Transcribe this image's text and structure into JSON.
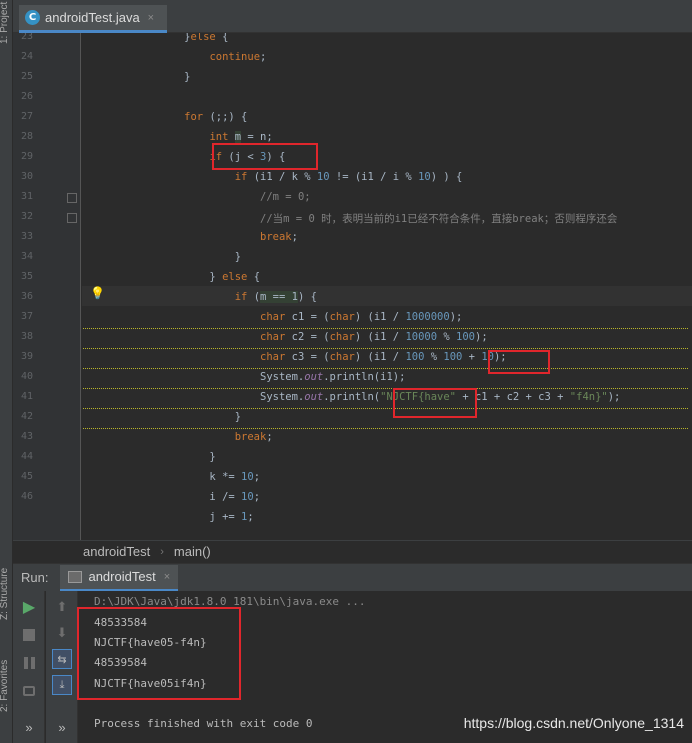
{
  "sidebar": {
    "project": "1: Project",
    "structure": "Z: Structure",
    "favorites": "2: Favorites"
  },
  "tab": {
    "icon": "java-class-icon",
    "title": "androidTest.java",
    "close": "×"
  },
  "editor": {
    "line_numbers": [
      "23",
      "24",
      "25",
      "26",
      "27",
      "28",
      "29",
      "30",
      "31",
      "32",
      "33",
      "34",
      "35",
      "36",
      "37",
      "38",
      "39",
      "40",
      "41",
      "42",
      "43",
      "44",
      "45",
      "46"
    ]
  },
  "breadcrumb": {
    "class": "androidTest",
    "method": "main()",
    "sep": "›"
  },
  "run": {
    "label": "Run:",
    "tab_title": "androidTest",
    "close": "×",
    "command": "D:\\JDK\\Java\\jdk1.8.0_181\\bin\\java.exe ...",
    "output": [
      "48533584",
      "NJCTF{have05-f4n}",
      "48539584",
      "NJCTF{have05if4n}"
    ],
    "exit": "Process finished with exit code 0",
    "expand": "»"
  },
  "watermark": "https://blog.csdn.net/Onlyone_1314",
  "colors": {
    "background": "#2b2b2b",
    "keyword": "#cc7832",
    "number": "#6897bb",
    "string": "#6a8759",
    "highlight_box": "#e0262c",
    "run_green": "#59a869"
  }
}
